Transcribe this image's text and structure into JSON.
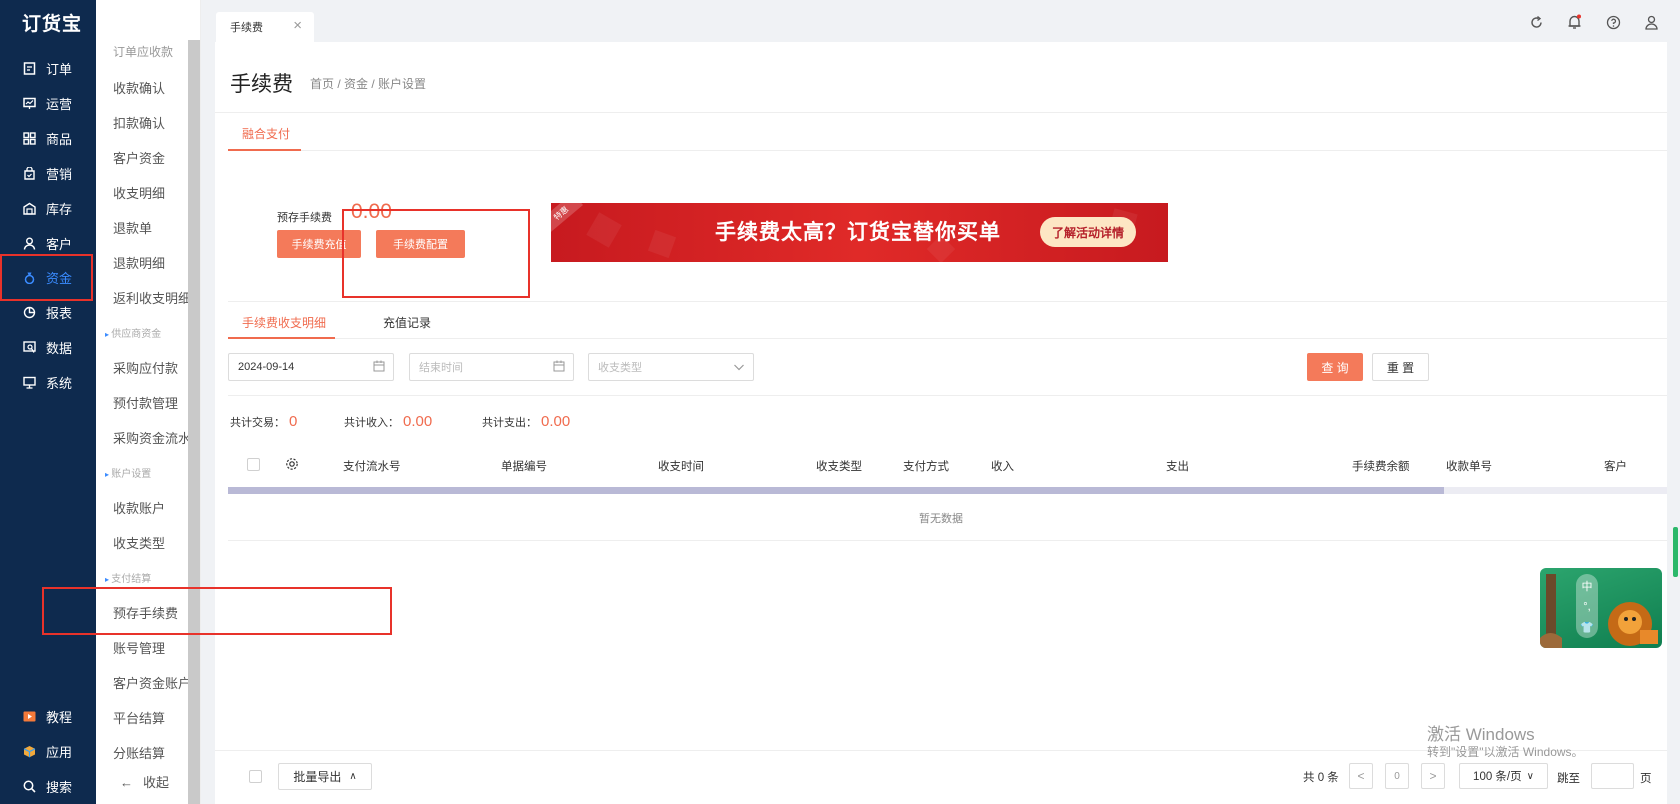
{
  "app": {
    "logo": "订货宝"
  },
  "leftnav": {
    "items": [
      {
        "label": "订单",
        "icon": "order-icon"
      },
      {
        "label": "运营",
        "icon": "operation-icon"
      },
      {
        "label": "商品",
        "icon": "product-icon"
      },
      {
        "label": "营销",
        "icon": "marketing-icon"
      },
      {
        "label": "库存",
        "icon": "warehouse-icon"
      },
      {
        "label": "客户",
        "icon": "customer-icon"
      },
      {
        "label": "资金",
        "icon": "money-bag-icon",
        "active": true
      },
      {
        "label": "报表",
        "icon": "pie-chart-icon"
      },
      {
        "label": "数据",
        "icon": "data-icon"
      },
      {
        "label": "系统",
        "icon": "monitor-icon"
      }
    ],
    "bottom": [
      {
        "label": "教程",
        "icon": "play-icon"
      },
      {
        "label": "应用",
        "icon": "cube-icon"
      },
      {
        "label": "搜索",
        "icon": "search-icon"
      }
    ]
  },
  "subnav": {
    "cut_item": "订单应收款",
    "items_a": [
      "收款确认",
      "扣款确认",
      "客户资金",
      "收支明细",
      "退款单",
      "退款明细",
      "返利收支明细"
    ],
    "group_supplier": "供应商资金",
    "items_b": [
      "采购应付款",
      "预付款管理",
      "采购资金流水"
    ],
    "group_account": "账户设置",
    "items_c": [
      "收款账户",
      "收支类型"
    ],
    "group_pay": "支付结算",
    "items_d": [
      "预存手续费",
      "账号管理",
      "客户资金账户",
      "平台结算",
      "分账结算"
    ],
    "collapse": "收起"
  },
  "topbar": {
    "tab_label": "手续费",
    "tab_close": "×"
  },
  "page": {
    "title": "手续费",
    "breadcrumb": "首页 / 资金 / 账户设置",
    "tab_main": "融合支付",
    "balance_label": "预存手续费",
    "balance_value": "0.00",
    "btn_recharge": "手续费充值",
    "btn_config": "手续费配置",
    "banner_text": "手续费太高？订货宝替你买单",
    "banner_btn": "了解活动详情",
    "banner_tag": "特惠",
    "tab_detail": "手续费收支明细",
    "tab_recharge": "充值记录"
  },
  "filters": {
    "start_date": "2024-09-14",
    "end_placeholder": "结束时间",
    "type_placeholder": "收支类型",
    "btn_query": "查 询",
    "btn_reset": "重 置"
  },
  "stats": {
    "trade_label": "共计交易：",
    "trade_value": "0",
    "income_label": "共计收入：",
    "income_value": "0.00",
    "expense_label": "共计支出：",
    "expense_value": "0.00"
  },
  "table": {
    "columns": [
      "支付流水号",
      "单据编号",
      "收支时间",
      "收支类型",
      "支付方式",
      "收入",
      "支出",
      "手续费余额",
      "收款单号",
      "客户"
    ],
    "empty_text": "暂无数据"
  },
  "footer": {
    "btn_export": "批量导出",
    "total": "共 0 条",
    "page_num": "0",
    "page_size": "100 条/页",
    "jump_label": "跳至",
    "page_unit": "页"
  },
  "mascot": {
    "chars": [
      "中",
      "°,",
      "👕"
    ]
  },
  "watermark": {
    "line1": "激活 Windows",
    "line2": "转到\"设置\"以激活 Windows。"
  }
}
